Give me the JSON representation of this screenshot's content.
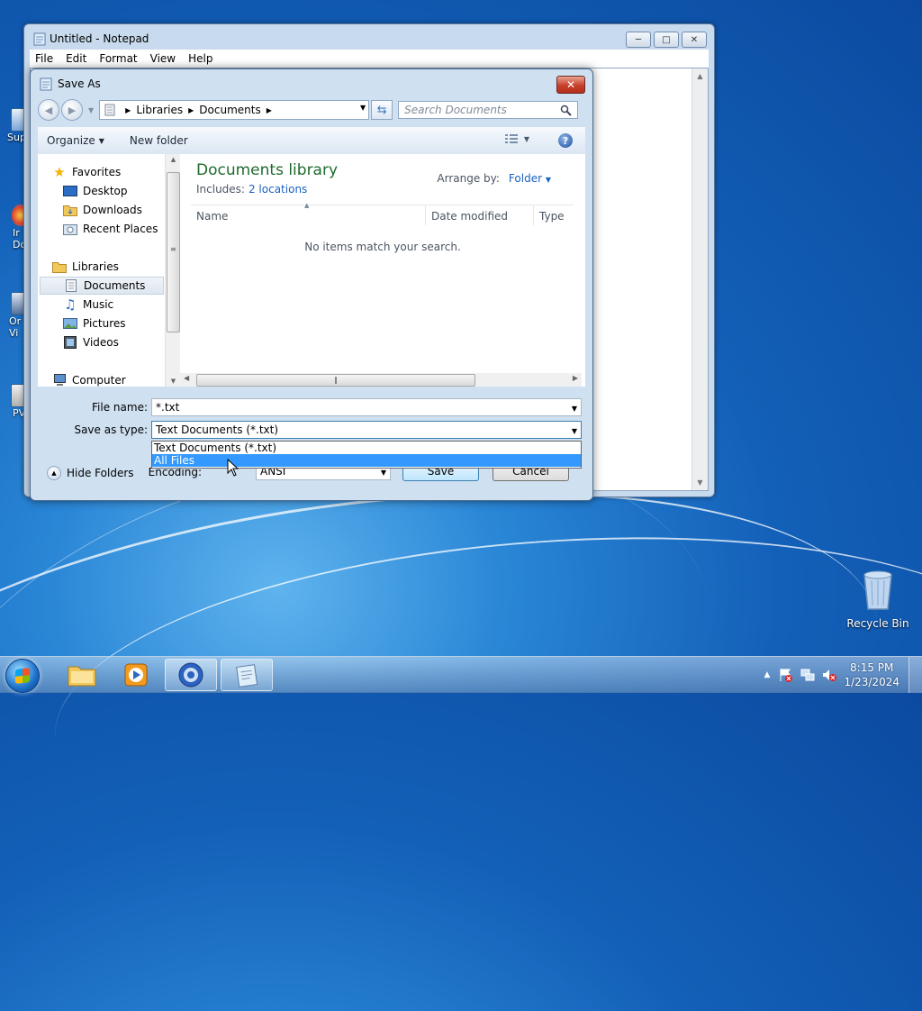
{
  "notepad": {
    "title": "Untitled - Notepad",
    "menu": [
      "File",
      "Edit",
      "Format",
      "View",
      "Help"
    ]
  },
  "dialog": {
    "title": "Save As",
    "address": [
      "Libraries",
      "Documents"
    ],
    "search_placeholder": "Search Documents",
    "toolbar": {
      "organize": "Organize",
      "new_folder": "New folder"
    },
    "nav": {
      "favorites": "Favorites",
      "desktop": "Desktop",
      "downloads": "Downloads",
      "recent": "Recent Places",
      "libraries": "Libraries",
      "documents": "Documents",
      "music": "Music",
      "pictures": "Pictures",
      "videos": "Videos",
      "computer": "Computer"
    },
    "library_title": "Documents library",
    "includes_label": "Includes:",
    "includes_link": "2 locations",
    "arrange_label": "Arrange by:",
    "arrange_value": "Folder",
    "columns": {
      "name": "Name",
      "date": "Date modified",
      "type": "Type"
    },
    "empty_message": "No items match your search.",
    "file_name_label": "File name:",
    "file_name_value": "*.txt",
    "save_type_label": "Save as type:",
    "save_type_value": "Text Documents (*.txt)",
    "save_type_options": [
      "Text Documents (*.txt)",
      "All Files"
    ],
    "encoding_label": "Encoding:",
    "encoding_value": "ANSI",
    "save_button": "Save",
    "cancel_button": "Cancel",
    "hide_folders": "Hide Folders"
  },
  "desktop": {
    "recycle_bin": "Recycle Bin",
    "edge_labels": [
      "Sup",
      "Ir\nDo",
      "Or\nVi",
      "PV"
    ]
  },
  "taskbar": {
    "time": "8:15 PM",
    "date": "1/23/2024"
  },
  "colors": {
    "library_title": "#1e6b2e",
    "link": "#1a62c2",
    "highlight": "#3399ff"
  }
}
